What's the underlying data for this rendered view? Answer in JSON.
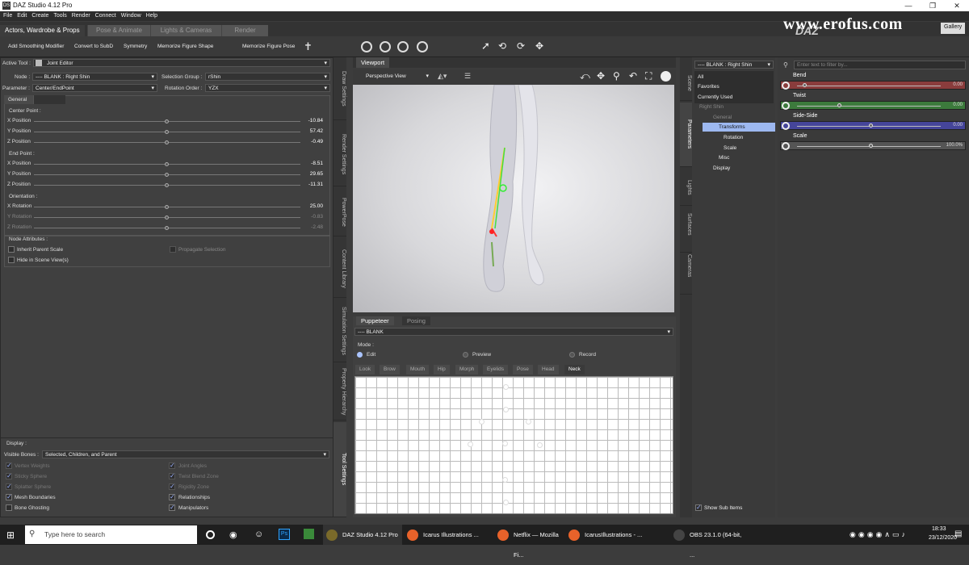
{
  "window": {
    "title": "DAZ Studio 4.12 Pro",
    "app_icon": "DS"
  },
  "menu": [
    "File",
    "Edit",
    "Create",
    "Tools",
    "Render",
    "Connect",
    "Window",
    "Help"
  ],
  "tabs": [
    "Actors, Wardrobe & Props",
    "Pose & Animate",
    "Lights & Cameras",
    "Render"
  ],
  "gallery_label": "Gallery",
  "watermark": "www.erofus.com",
  "toolbar": {
    "add_smoothing": "Add Smoothing Modifier",
    "convert_subd": "Convert to SubD",
    "symmetry": "Symmetry",
    "memorize_shape": "Memorize Figure Shape",
    "memorize_pose": "Memorize Figure Pose"
  },
  "tool_settings": {
    "active_tool_label": "Active Tool :",
    "active_tool": "Joint Editor",
    "node_label": "Node :",
    "node": "---- BLANK : Right Shin",
    "selection_group_label": "Selection Group :",
    "selection_group": "rShin",
    "parameter_label": "Parameter :",
    "parameter": "Center/EndPoint",
    "rotation_order_label": "Rotation Order :",
    "rotation_order": "YZX",
    "general_tab": "General",
    "center_point": "Center Point :",
    "end_point": "End Point :",
    "orientation": "Orientation :",
    "node_attributes": "Node Attributes :",
    "inherit_parent_scale": "Inherit Parent Scale",
    "propagate_selection": "Propagate Selection",
    "hide_in_scene": "Hide in Scene View(s)",
    "display": "Display :",
    "visible_bones_label": "Visible Bones :",
    "visible_bones": "Selected, Children, and Parent",
    "vertex_weights": "Vertex Weights",
    "joint_angles": "Joint Angles",
    "bone_ghosting": "Bone Ghosting",
    "manipulators": "Manipulators",
    "relationships": "Relationships",
    "mesh_boundaries": "Mesh Boundaries",
    "dim1": "Sticky Sphere",
    "dim2": "Twist Blend Zone",
    "dim3": "Splatter Sphere",
    "dim4": "Rigidity Zone"
  },
  "center": [
    {
      "label": "X Position",
      "value": "-10.84",
      "pos": 0.5,
      "dim": false
    },
    {
      "label": "Y Position",
      "value": "57.42",
      "pos": 0.5,
      "dim": false
    },
    {
      "label": "Z Position",
      "value": "-0.49",
      "pos": 0.5,
      "dim": false
    }
  ],
  "end": [
    {
      "label": "X Position",
      "value": "-8.51",
      "pos": 0.5,
      "dim": false
    },
    {
      "label": "Y Position",
      "value": "29.65",
      "pos": 0.5,
      "dim": false
    },
    {
      "label": "Z Position",
      "value": "-11.31",
      "pos": 0.5,
      "dim": false
    }
  ],
  "orient": [
    {
      "label": "X Rotation",
      "value": "25.00",
      "pos": 0.5,
      "dim": false
    },
    {
      "label": "Y Rotation",
      "value": "-0.83",
      "pos": 0.5,
      "dim": true
    },
    {
      "label": "Z Rotation",
      "value": "-2.48",
      "pos": 0.5,
      "dim": true
    }
  ],
  "left_vtabs": [
    "Draw Settings",
    "Render Settings",
    "PowerPose",
    "Content Library",
    "Simulation Settings",
    "Property Hierarchy",
    "Tool Settings"
  ],
  "viewport": {
    "tab": "Viewport",
    "camera": "Perspective View"
  },
  "puppeteer": {
    "tab1": "Puppeteer",
    "tab2": "Posing",
    "node": "---- BLANK",
    "mode_label": "Mode :",
    "modes": [
      "Edit",
      "Preview",
      "Record"
    ],
    "groups": [
      "Look",
      "Brow",
      "Mouth",
      "Hip",
      "Morph",
      "Eyelids",
      "Pose",
      "Head",
      "Neck"
    ]
  },
  "right_vtabs": [
    "Scene",
    "Parameters",
    "Lights",
    "Surfaces",
    "Cameras"
  ],
  "params": {
    "node": "---- BLANK : Right Shin",
    "filter_placeholder": "Enter text to filter by...",
    "tree": [
      "All",
      "Favorites",
      "Currently Used",
      "Right Shin",
      "General",
      "Transforms",
      "Rotation",
      "Scale",
      "Misc",
      "Display"
    ],
    "show_sub_items": "Show Sub Items",
    "sliders": [
      {
        "label": "Bend",
        "value": "0.00",
        "pos": 0.04,
        "color": "#8a3c3c"
      },
      {
        "label": "Twist",
        "value": "0.00",
        "pos": 0.28,
        "color": "#3c7a3c"
      },
      {
        "label": "Side-Side",
        "value": "0.00",
        "pos": 0.5,
        "color": "#45459a"
      },
      {
        "label": "Scale",
        "value": "100.0%",
        "pos": 0.5,
        "color": "#555555"
      }
    ]
  },
  "taskbar": {
    "search": "Type here to search",
    "apps": [
      {
        "label": "DAZ Studio 4.12 Pro",
        "color": "#7a6a2a"
      },
      {
        "label": "Icarus Illustrations ...",
        "color": "#e8622a"
      },
      {
        "label": "Netflix — Mozilla Fi...",
        "color": "#e8622a"
      },
      {
        "label": "IcarusIllustrations - ...",
        "color": "#e8622a"
      },
      {
        "label": "OBS 23.1.0 (64-bit, ...",
        "color": "#444444"
      }
    ],
    "time": "18:33",
    "date": "23/12/2020"
  }
}
